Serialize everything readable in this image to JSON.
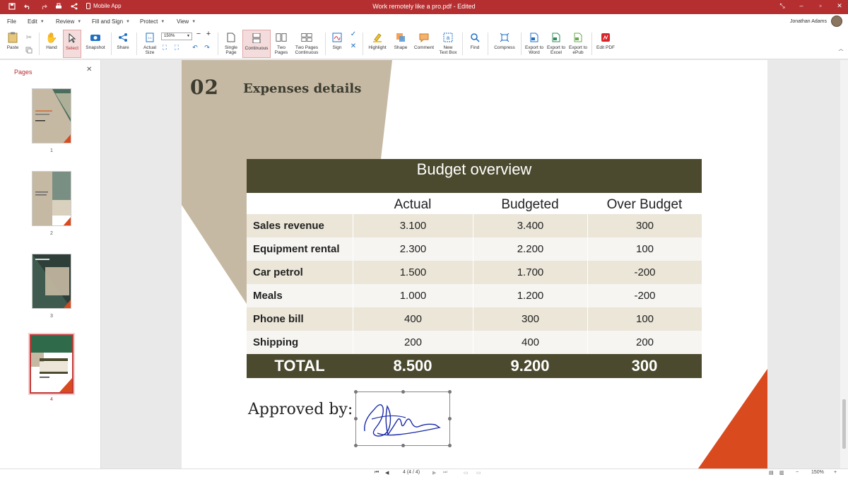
{
  "app": {
    "window_title": "Work remotely like a pro.pdf - Edited",
    "mobile_app_label": "Mobile App",
    "user_name": "Jonathan Adams"
  },
  "menu": [
    "File",
    "Edit",
    "Review",
    "Fill and Sign",
    "Protect",
    "View"
  ],
  "ribbon": {
    "paste": "Paste",
    "hand": "Hand",
    "select": "Select",
    "snapshot": "Snapshot",
    "share": "Share",
    "actual_size": "Actual Size",
    "zoom": "150%",
    "single_page": "Single Page",
    "continuous": "Continuous",
    "two_pages": "Two Pages",
    "two_pages_continuous": "Two Pages Continuous",
    "sign": "Sign",
    "highlight": "Highlight",
    "shape": "Shape",
    "comment": "Comment",
    "new_text_box": "New Text Box",
    "find": "Find",
    "compress": "Compress",
    "export_word": "Export to Word",
    "export_excel": "Export to Excel",
    "export_epub": "Export to ePub",
    "edit_pdf": "Edit PDF"
  },
  "pages_panel": {
    "title": "Pages",
    "thumbnails": [
      "1",
      "2",
      "3",
      "4"
    ],
    "selected": "4"
  },
  "document": {
    "section_number": "02",
    "section_title": "Expenses details",
    "table": {
      "title": "Budget overview",
      "columns": [
        "",
        "Actual",
        "Budgeted",
        "Over Budget"
      ],
      "rows": [
        [
          "Sales revenue",
          "3.100",
          "3.400",
          "300"
        ],
        [
          "Equipment rental",
          "2.300",
          "2.200",
          "100"
        ],
        [
          "Car petrol",
          "1.500",
          "1.700",
          "-200"
        ],
        [
          "Meals",
          "1.000",
          "1.200",
          "-200"
        ],
        [
          "Phone bill",
          "400",
          "300",
          "100"
        ],
        [
          "Shipping",
          "200",
          "400",
          "200"
        ]
      ],
      "total": [
        "TOTAL",
        "8.500",
        "9.200",
        "300"
      ]
    },
    "approved_by": "Approved by:"
  },
  "status": {
    "page_indicator": "4 (4 / 4)",
    "zoom": "150%"
  },
  "colors": {
    "titlebar": "#b52f31",
    "table_dark": "#4b4a2e",
    "accent_orange": "#d94a1e",
    "beige": "#c6b9a3"
  }
}
